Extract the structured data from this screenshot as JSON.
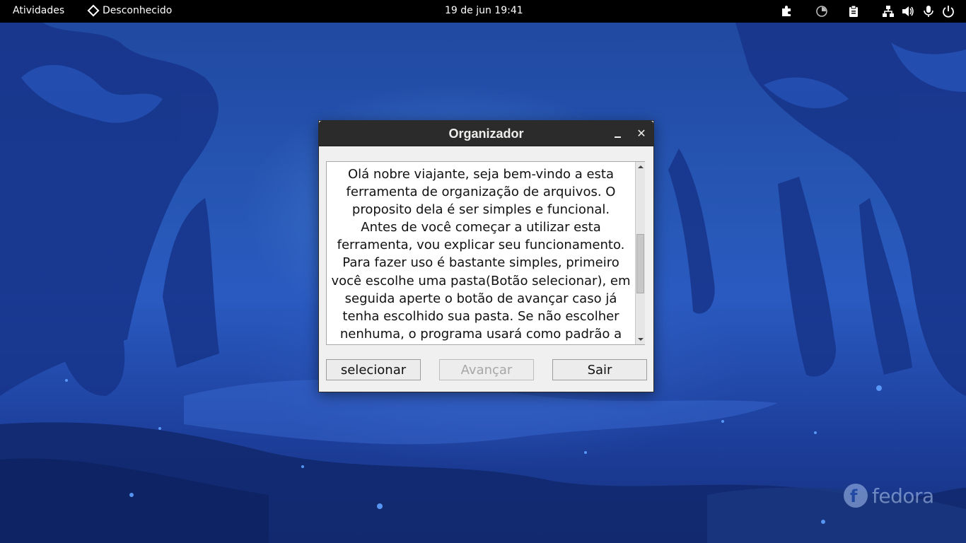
{
  "topbar": {
    "activities": "Atividades",
    "app_name": "Desconhecido",
    "clock": "19 de jun  19:41",
    "tray_icons": [
      "puzzle-extension-icon",
      "night-light-icon",
      "clipboard-icon",
      "network-wired-icon",
      "volume-icon",
      "microphone-icon",
      "power-icon"
    ]
  },
  "window": {
    "title": "Organizador",
    "text": "Olá nobre viajante, seja bem-vindo a esta ferramenta de organização de arquivos. O proposito dela é ser simples e funcional.\nAntes de você começar a utilizar esta ferramenta, vou explicar seu funcionamento. Para fazer uso é bastante simples, primeiro você escolhe uma pasta(Botão selecionar), em seguida aperte o botão de avançar caso já tenha escolhido sua pasta. Se não escolher nenhuma, o programa usará como padrão  a",
    "scroll_position": 0.6,
    "buttons": {
      "select": "selecionar",
      "next": "Avançar",
      "exit": "Sair"
    },
    "next_disabled": true
  },
  "wallpaper": {
    "brand": "fedora"
  },
  "colors": {
    "topbar_bg": "#000000",
    "titlebar_bg": "#2b2b2b",
    "window_bg": "#f0f0f0",
    "wallpaper_blue": "#2757b6"
  }
}
